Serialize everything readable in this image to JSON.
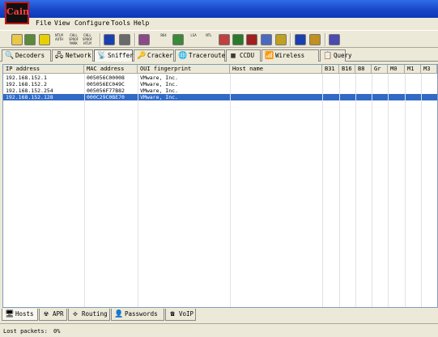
{
  "app": {
    "logo_text": "Cain"
  },
  "menu": [
    "File",
    "View",
    "Configure",
    "Tools",
    "Help"
  ],
  "toolbar": {
    "buttons": [
      {
        "icon": "folder-icon",
        "color": "#e8c84a"
      },
      {
        "icon": "network-sniffer-icon",
        "color": "#5a8a3a"
      },
      {
        "icon": "radiation-icon",
        "color": "#e8d000"
      },
      {
        "icon": "ntlm-auth-icon",
        "text": "NTLM AUTH"
      },
      {
        "icon": "challenge-spoof-icon",
        "text": "CHLL SPOOF MARK"
      },
      {
        "icon": "challenge-spoof-icon-2",
        "text": "CHLL SPOOF HTLM"
      },
      {
        "icon": "add-icon",
        "color": "#1a3fb0"
      },
      {
        "icon": "tools-icon",
        "color": "#6a6a6a"
      },
      {
        "icon": "hash-icon",
        "color": "#8a4a8a"
      },
      {
        "icon": "base64-icon",
        "text": "B64"
      },
      {
        "icon": "rdp-icon",
        "color": "#3a8a3a"
      },
      {
        "icon": "lsa-icon",
        "text": "LSA"
      },
      {
        "icon": "ntl-icon",
        "text": "NTL"
      },
      {
        "icon": "pwl-icon",
        "color": "#c04040"
      },
      {
        "icon": "mail-icon",
        "color": "#2a7a2a"
      },
      {
        "icon": "mobile-icon",
        "color": "#a02020"
      },
      {
        "icon": "network-scan-icon",
        "color": "#4a6ac0"
      },
      {
        "icon": "cert-icon",
        "color": "#c0a020"
      },
      {
        "icon": "info-icon",
        "color": "#1a3fb0"
      },
      {
        "icon": "help-icon",
        "color": "#c09020"
      },
      {
        "icon": "exit-icon",
        "color": "#4a4ab0"
      }
    ]
  },
  "tabs": [
    {
      "label": "Decoders",
      "icon": "decoders-icon",
      "glyph": "🔍"
    },
    {
      "label": "Network",
      "icon": "network-icon",
      "glyph": "🖧"
    },
    {
      "label": "Sniffer",
      "icon": "sniffer-icon",
      "glyph": "📡",
      "active": true
    },
    {
      "label": "Cracker",
      "icon": "cracker-icon",
      "glyph": "🔑"
    },
    {
      "label": "Traceroute",
      "icon": "traceroute-icon",
      "glyph": "🌐"
    },
    {
      "label": "CCDU",
      "icon": "ccdu-icon",
      "glyph": "▦"
    },
    {
      "label": "Wireless",
      "icon": "wireless-icon",
      "glyph": "📶"
    },
    {
      "label": "Query",
      "icon": "query-icon",
      "glyph": "📋"
    }
  ],
  "table": {
    "columns": [
      "IP address",
      "MAC address",
      "OUI fingerprint",
      "Host name",
      "B31",
      "B16",
      "B8",
      "Gr",
      "M0",
      "M1",
      "M3"
    ],
    "rows": [
      {
        "ip": "192.168.152.1",
        "mac": "005056C00008",
        "oui": "VMware, Inc."
      },
      {
        "ip": "192.168.152.2",
        "mac": "005056EC049C",
        "oui": "VMware, Inc."
      },
      {
        "ip": "192.168.152.254",
        "mac": "005056F77B82",
        "oui": "VMware, Inc."
      },
      {
        "ip": "192.168.152.128",
        "mac": "000C29C0BE70",
        "oui": "VMware, Inc.",
        "selected": true
      }
    ]
  },
  "bottom_tabs": [
    {
      "label": "Hosts",
      "icon": "hosts-icon",
      "glyph": "🖥",
      "active": true
    },
    {
      "label": "APR",
      "icon": "apr-icon",
      "glyph": "☢"
    },
    {
      "label": "Routing",
      "icon": "routing-icon",
      "glyph": "✣"
    },
    {
      "label": "Passwords",
      "icon": "passwords-icon",
      "glyph": "👤"
    },
    {
      "label": "VoIP",
      "icon": "voip-icon",
      "glyph": "☎"
    }
  ],
  "status": {
    "label": "Lost packets:",
    "value": "0%"
  }
}
